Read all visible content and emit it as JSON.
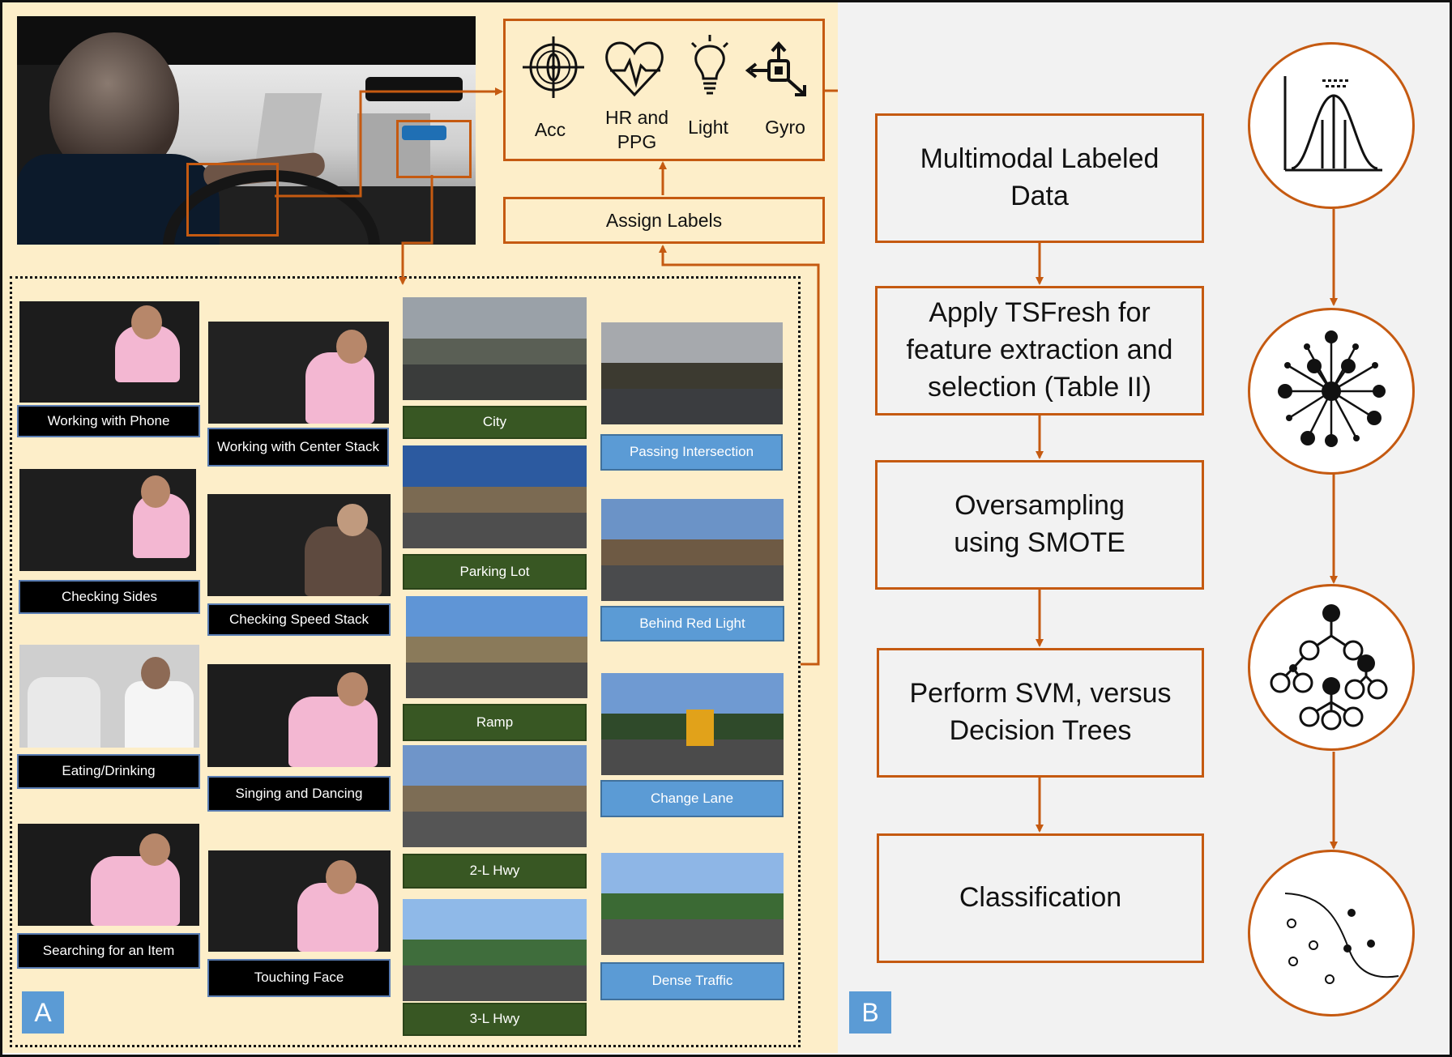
{
  "panel_a": {
    "tag": "A",
    "sensors": [
      {
        "label": "Acc",
        "icon": "accelerometer-icon"
      },
      {
        "label": "HR and PPG",
        "icon": "heart-rate-icon"
      },
      {
        "label": "Light",
        "icon": "light-bulb-icon"
      },
      {
        "label": "Gyro",
        "icon": "gyroscope-icon"
      }
    ],
    "assign_labels": "Assign Labels",
    "driver_activities": [
      "Working with Phone",
      "Working with Center Stack",
      "Checking Sides",
      "Checking Speed Stack",
      "Eating/Drinking",
      "Singing and Dancing",
      "Searching for an Item",
      "Touching Face"
    ],
    "road_types": [
      "City",
      "Parking Lot",
      "Ramp",
      "2-L Hwy",
      "3-L Hwy"
    ],
    "road_events": [
      "Passing Intersection",
      "Behind Red Light",
      "Change Lane",
      "Dense Traffic"
    ]
  },
  "panel_b": {
    "tag": "B",
    "steps": [
      "Multimodal Labeled Data",
      "Apply TSFresh for feature extraction and selection (Table II)",
      "Oversampling using SMOTE",
      "Perform SVM, versus Decision Trees",
      "Classification"
    ],
    "icons": [
      "distribution-curve-icon",
      "feature-network-icon",
      "decision-tree-icon",
      "classification-boundary-icon"
    ]
  },
  "colors": {
    "panel_a_bg": "#fdeec9",
    "panel_b_bg": "#f2f2f2",
    "accent_orange": "#c55a11",
    "driver_label": "#000000",
    "road_type_label": "#385723",
    "road_event_label": "#5b9bd5"
  }
}
